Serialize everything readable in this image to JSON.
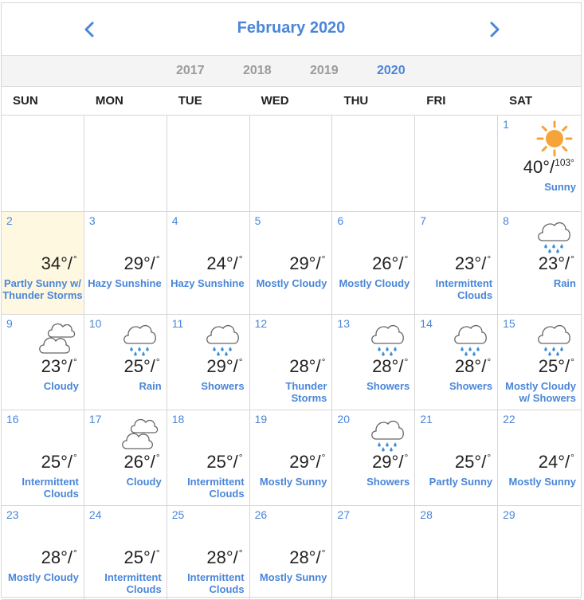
{
  "header": {
    "month_title": "February 2020"
  },
  "years": [
    {
      "label": "2017",
      "active": false
    },
    {
      "label": "2018",
      "active": false
    },
    {
      "label": "2019",
      "active": false
    },
    {
      "label": "2020",
      "active": true
    }
  ],
  "weekdays": [
    "SUN",
    "MON",
    "TUE",
    "WED",
    "THU",
    "FRI",
    "SAT"
  ],
  "degree_symbol": "°",
  "days": [
    null,
    null,
    null,
    null,
    null,
    null,
    {
      "date": "1",
      "hi": "40°",
      "lo": "103°",
      "cond": "Sunny",
      "icon": "sun-icon"
    },
    {
      "date": "2",
      "hi": "34°",
      "cond": "Partly Sunny w/ Thunder Storms",
      "today": true
    },
    {
      "date": "3",
      "hi": "29°",
      "cond": "Hazy Sunshine"
    },
    {
      "date": "4",
      "hi": "24°",
      "cond": "Hazy Sunshine"
    },
    {
      "date": "5",
      "hi": "29°",
      "cond": "Mostly Cloudy"
    },
    {
      "date": "6",
      "hi": "26°",
      "cond": "Mostly Cloudy"
    },
    {
      "date": "7",
      "hi": "23°",
      "cond": "Intermittent Clouds"
    },
    {
      "date": "8",
      "hi": "23°",
      "cond": "Rain",
      "icon": "rain-icon"
    },
    {
      "date": "9",
      "hi": "23°",
      "cond": "Cloudy",
      "icon": "cloudy-icon"
    },
    {
      "date": "10",
      "hi": "25°",
      "cond": "Rain",
      "icon": "rain-icon"
    },
    {
      "date": "11",
      "hi": "29°",
      "cond": "Showers",
      "icon": "rain-icon"
    },
    {
      "date": "12",
      "hi": "28°",
      "cond": "Thunder Storms"
    },
    {
      "date": "13",
      "hi": "28°",
      "cond": "Showers",
      "icon": "rain-icon"
    },
    {
      "date": "14",
      "hi": "28°",
      "cond": "Showers",
      "icon": "rain-icon"
    },
    {
      "date": "15",
      "hi": "25°",
      "cond": "Mostly Cloudy w/ Showers",
      "icon": "rain-icon"
    },
    {
      "date": "16",
      "hi": "25°",
      "cond": "Intermittent Clouds"
    },
    {
      "date": "17",
      "hi": "26°",
      "cond": "Cloudy",
      "icon": "cloudy-icon"
    },
    {
      "date": "18",
      "hi": "25°",
      "cond": "Intermittent Clouds"
    },
    {
      "date": "19",
      "hi": "29°",
      "cond": "Mostly Sunny"
    },
    {
      "date": "20",
      "hi": "29°",
      "cond": "Showers",
      "icon": "rain-icon"
    },
    {
      "date": "21",
      "hi": "25°",
      "cond": "Partly Sunny"
    },
    {
      "date": "22",
      "hi": "24°",
      "cond": "Mostly Sunny"
    },
    {
      "date": "23",
      "hi": "28°",
      "cond": "Mostly Cloudy"
    },
    {
      "date": "24",
      "hi": "25°",
      "cond": "Intermittent Clouds"
    },
    {
      "date": "25",
      "hi": "28°",
      "cond": "Intermittent Clouds"
    },
    {
      "date": "26",
      "hi": "28°",
      "cond": "Mostly Sunny"
    },
    {
      "date": "27"
    },
    {
      "date": "28"
    },
    {
      "date": "29"
    }
  ],
  "colors": {
    "accent": "#4a86d8",
    "today_bg": "#fff8e1",
    "sun": "#f5a33a",
    "rain_drop": "#3b8fd9",
    "cloud_stroke": "#666666"
  }
}
